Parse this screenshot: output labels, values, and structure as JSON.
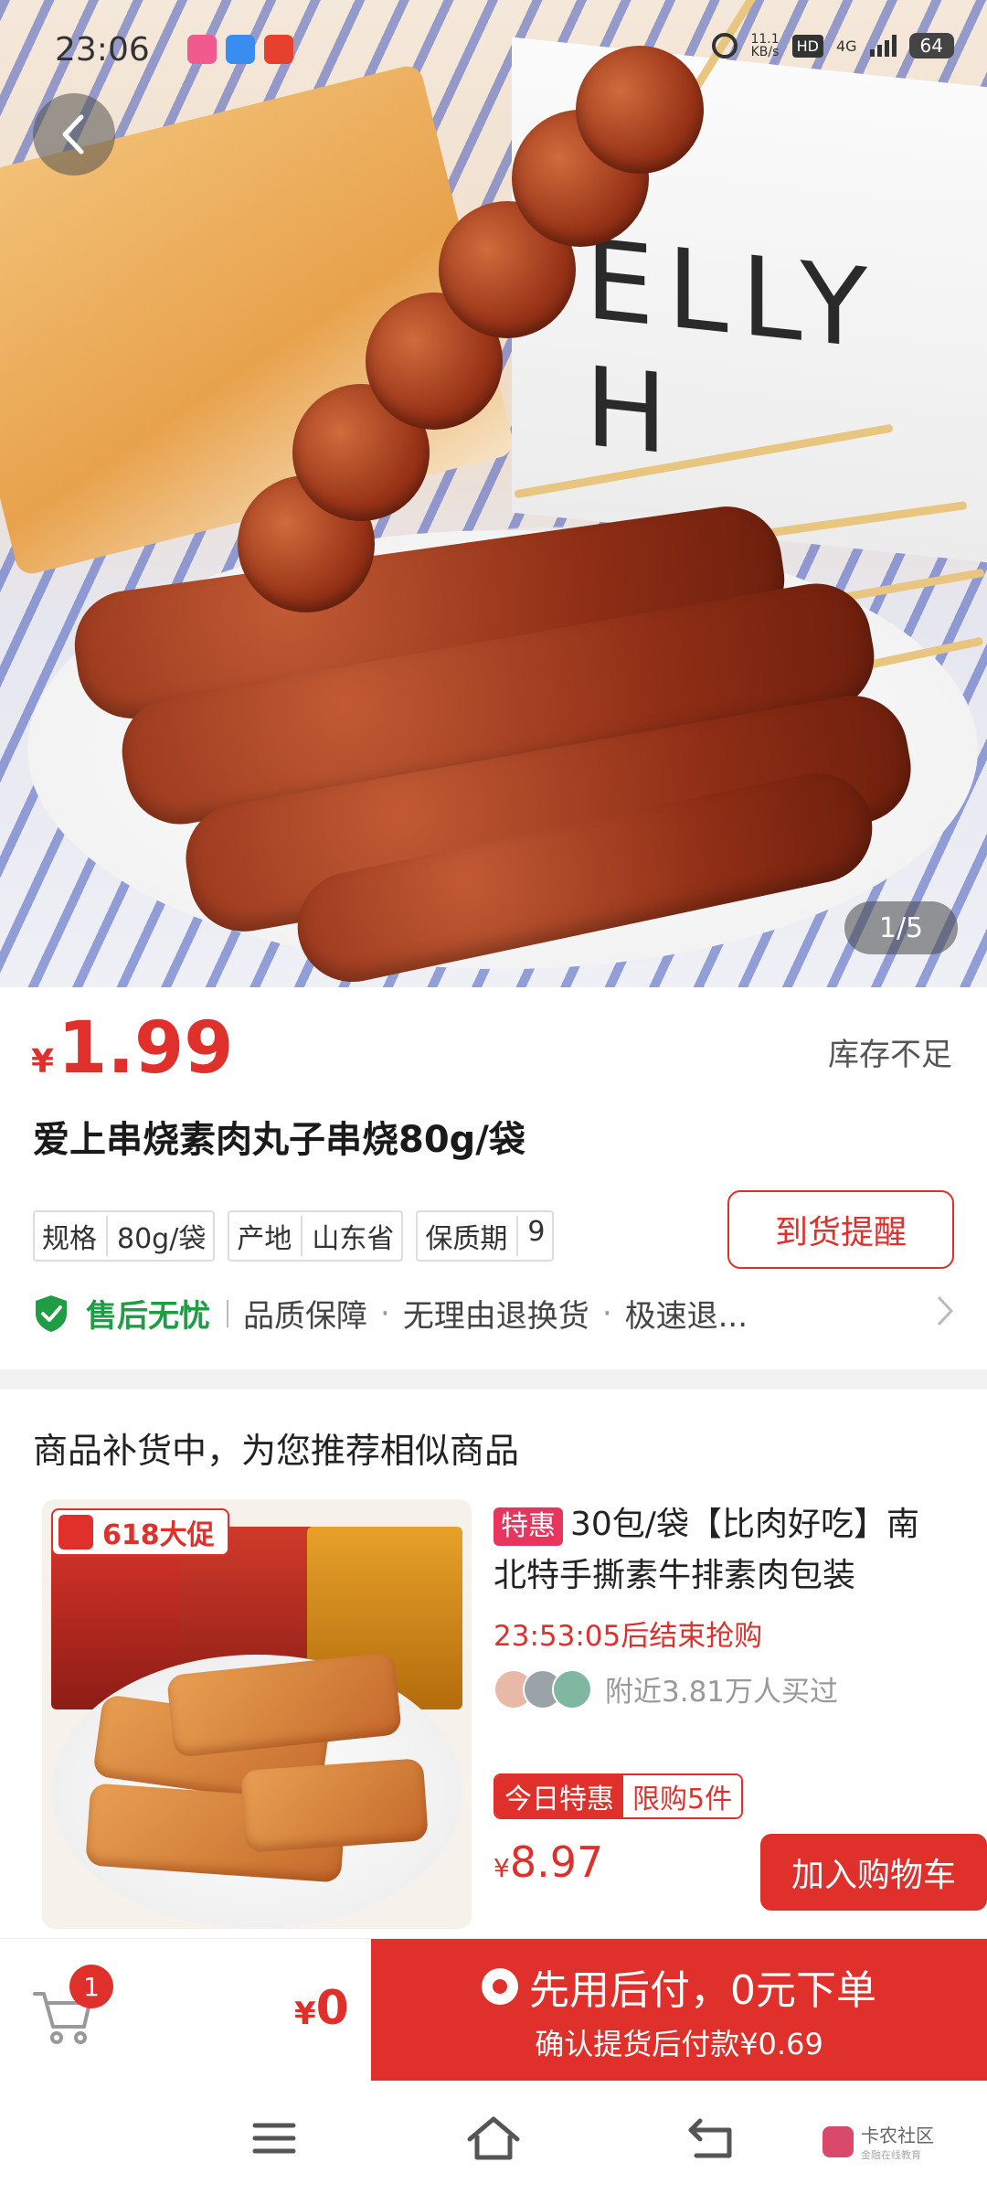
{
  "status_bar": {
    "time": "23:06",
    "net_speed_value": "11.1",
    "net_speed_unit": "KB/s",
    "hd_label": "HD",
    "network": "4G",
    "battery": "64"
  },
  "gallery": {
    "box_text": "ELLY H",
    "page_indicator": "1/5"
  },
  "product": {
    "currency": "¥",
    "price": "1.99",
    "stock_status": "库存不足",
    "title": "爱上串烧素肉丸子串烧80g/袋",
    "specs": [
      {
        "key": "规格",
        "value": "80g/袋"
      },
      {
        "key": "产地",
        "value": "山东省"
      },
      {
        "key": "保质期",
        "value": "9"
      }
    ],
    "remind_button": "到货提醒"
  },
  "after_sale": {
    "title": "售后无忧",
    "items": [
      "品质保障",
      "无理由退换货",
      "极速退..."
    ],
    "dot": "·"
  },
  "recommend": {
    "heading": "商品补货中，为您推荐相似商品",
    "promo_badge": "618大促",
    "tag": "特惠",
    "title": "30包/袋【比肉好吃】南北特手撕素牛排素肉包装",
    "countdown": "23:53:05后结束抢购",
    "buyers": "附近3.81万人买过",
    "deal_tag_a": "今日特惠",
    "deal_tag_b": "限购5件",
    "currency": "¥",
    "price": "8.97",
    "cart_button": "加入购物车"
  },
  "action_bar": {
    "cart_count": "1",
    "currency": "¥",
    "total": "0",
    "checkout_line1": "先用后付，0元下单",
    "checkout_line2": "确认提货后付款¥0.69"
  },
  "watermark": {
    "line1": "卡农社区",
    "line2": "金融在线教育"
  },
  "colors": {
    "accent": "#e0302b",
    "aftersale_green": "#1f9d45",
    "tag_pink": "#e8355e"
  }
}
